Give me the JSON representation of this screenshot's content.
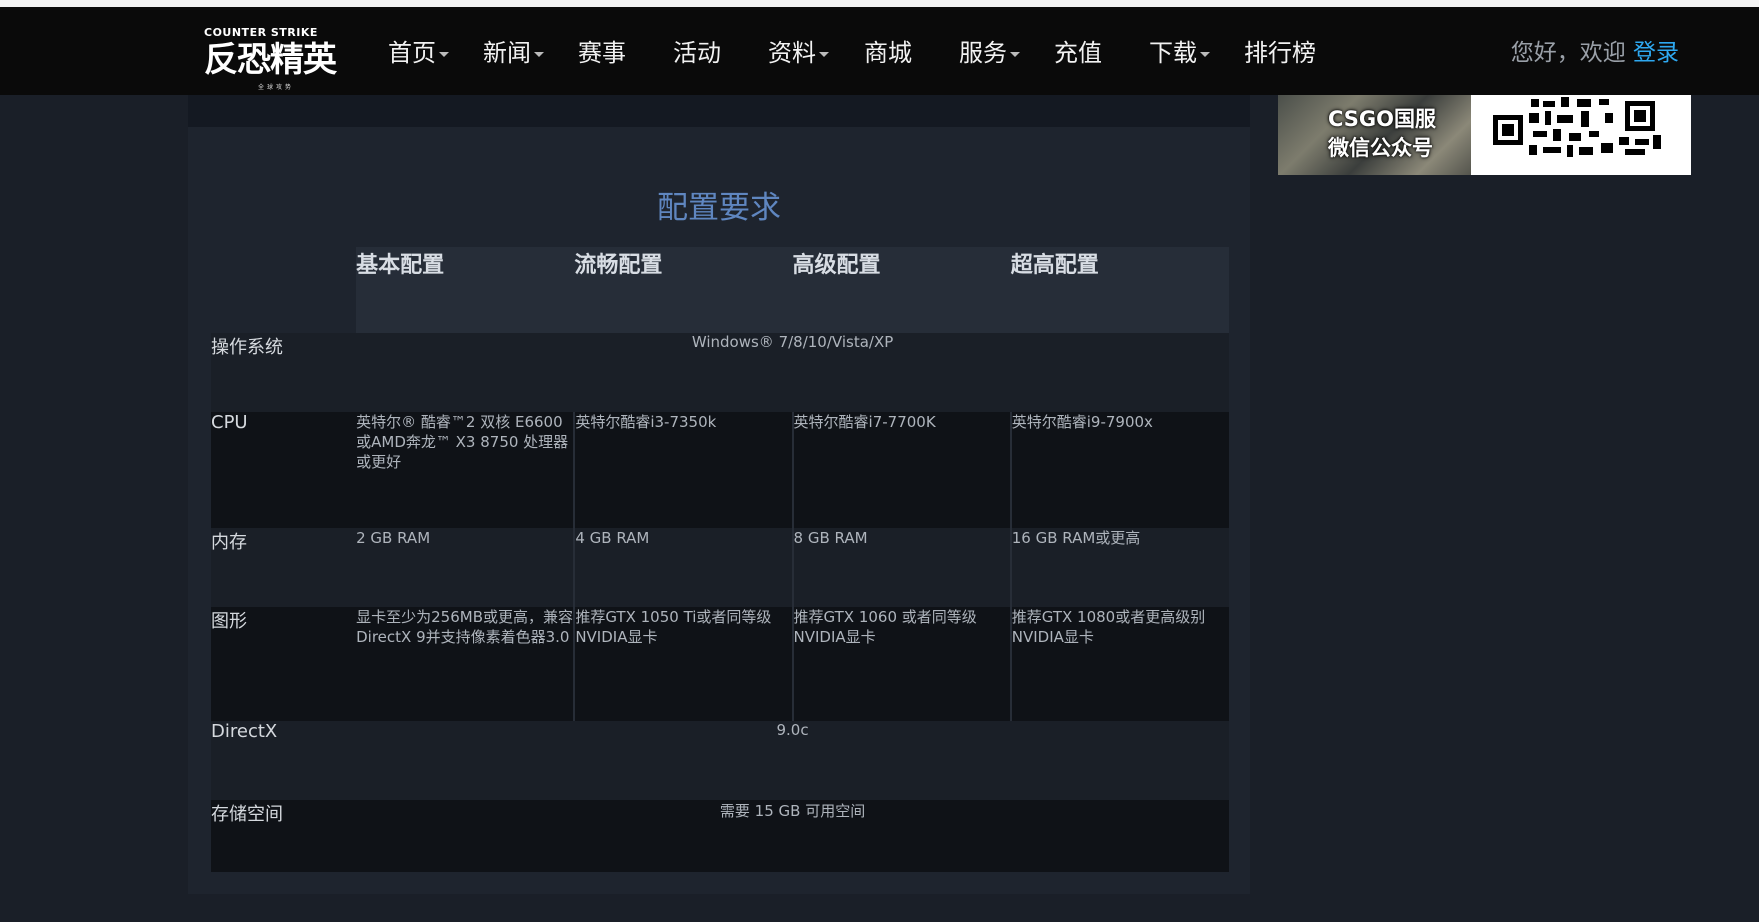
{
  "logo": {
    "en": "COUNTER STRIKE",
    "cn": "反恐精英",
    "sub": "全球攻势"
  },
  "nav": {
    "items": [
      {
        "label": "首页",
        "dropdown": true
      },
      {
        "label": "新闻",
        "dropdown": true
      },
      {
        "label": "赛事",
        "dropdown": false
      },
      {
        "label": "活动",
        "dropdown": false
      },
      {
        "label": "资料",
        "dropdown": true
      },
      {
        "label": "商城",
        "dropdown": false
      },
      {
        "label": "服务",
        "dropdown": true
      },
      {
        "label": "充值",
        "dropdown": false
      },
      {
        "label": "下载",
        "dropdown": true
      },
      {
        "label": "排行榜",
        "dropdown": false
      }
    ],
    "greeting": "您好，欢迎",
    "login": "登录"
  },
  "banner": {
    "label_line1": "CSGO国服",
    "label_line2": "微信公众号"
  },
  "specs": {
    "title": "配置要求",
    "columns": [
      "基本配置",
      "流畅配置",
      "高级配置",
      "超高配置"
    ],
    "rows": {
      "os": {
        "label": "操作系统",
        "value": "Windows® 7/8/10/Vista/XP"
      },
      "cpu": {
        "label": "CPU",
        "values": [
          "英特尔® 酷睿™2 双核 E6600或AMD奔龙™ X3 8750 处理器或更好",
          "英特尔酷睿i3-7350k",
          "英特尔酷睿i7-7700K",
          "英特尔酷睿i9-7900x"
        ]
      },
      "ram": {
        "label": "内存",
        "values": [
          "2 GB RAM",
          "4 GB RAM",
          "8 GB RAM",
          "16 GB RAM或更高"
        ]
      },
      "gpu": {
        "label": "图形",
        "values": [
          "显卡至少为256MB或更高，兼容DirectX 9并支持像素着色器3.0",
          "推荐GTX 1050 Ti或者同等级NVIDIA显卡",
          "推荐GTX 1060 或者同等级NVIDIA显卡",
          "推荐GTX 1080或者更高级别NVIDIA显卡"
        ]
      },
      "directx": {
        "label": "DirectX",
        "value": "9.0c"
      },
      "storage": {
        "label": "存储空间",
        "value": "需要 15 GB 可用空间"
      }
    }
  }
}
